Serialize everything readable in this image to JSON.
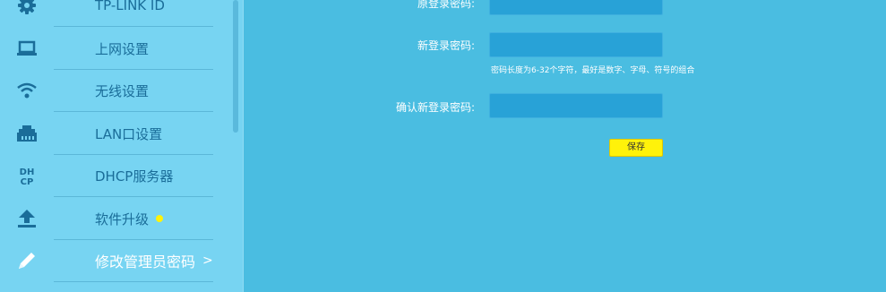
{
  "colors": {
    "main_background": "#4abde1",
    "sidebar_background": "#77d4f2",
    "nav_text": "#1a6d99",
    "active_text": "#ffffff",
    "input_background": "#28a2d7",
    "save_button": "#fff20a",
    "badge_dot": "#fff20a"
  },
  "sidebar": {
    "items": [
      {
        "label": "TP-LINK ID",
        "icon": "gear-icon"
      },
      {
        "label": "上网设置",
        "icon": "laptop-icon"
      },
      {
        "label": "无线设置",
        "icon": "wifi-icon"
      },
      {
        "label": "LAN口设置",
        "icon": "lan-port-icon"
      },
      {
        "label": "DHCP服务器",
        "icon": "dhcp-icon"
      },
      {
        "label": "软件升级",
        "icon": "upload-icon",
        "badge": true
      },
      {
        "label": "修改管理员密码",
        "icon": "pencil-icon",
        "active": true,
        "chevron": ">"
      }
    ]
  },
  "form": {
    "old_password_label": "原登录密码:",
    "new_password_label": "新登录密码:",
    "password_hint": "密码长度为6-32个字符，最好是数字、字母、符号的组合",
    "confirm_password_label": "确认新登录密码:",
    "save_label": "保存"
  }
}
